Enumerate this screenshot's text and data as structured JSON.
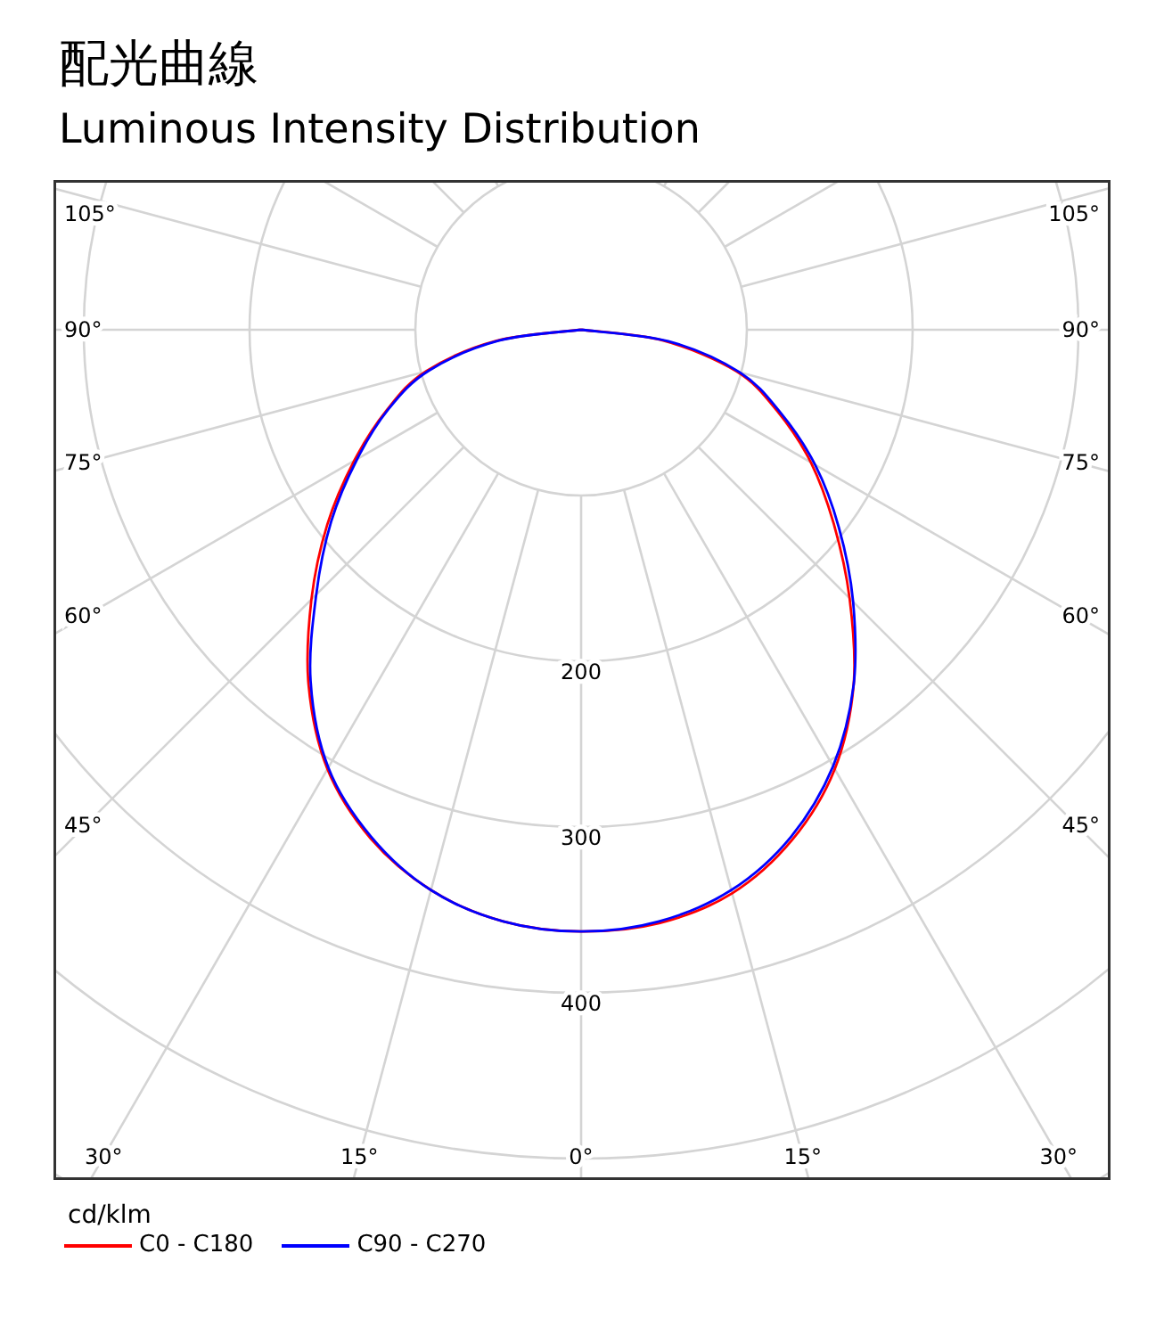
{
  "heading": "配光曲線",
  "subheading": "Luminous Intensity Distribution",
  "polar_plot": {
    "angle_labels": [
      "105°",
      "105°",
      "90°",
      "90°",
      "75°",
      "75°",
      "60°",
      "60°",
      "45°",
      "45°",
      "30°",
      "15°",
      "0°",
      "15°",
      "30°"
    ],
    "ring_labels": [
      "200",
      "300",
      "400"
    ]
  },
  "legend": {
    "unit": "cd/klm",
    "items": [
      {
        "label": "C0 - C180",
        "color": "#ff0000"
      },
      {
        "label": "C90 - C270",
        "color": "#0000ff"
      }
    ]
  }
}
